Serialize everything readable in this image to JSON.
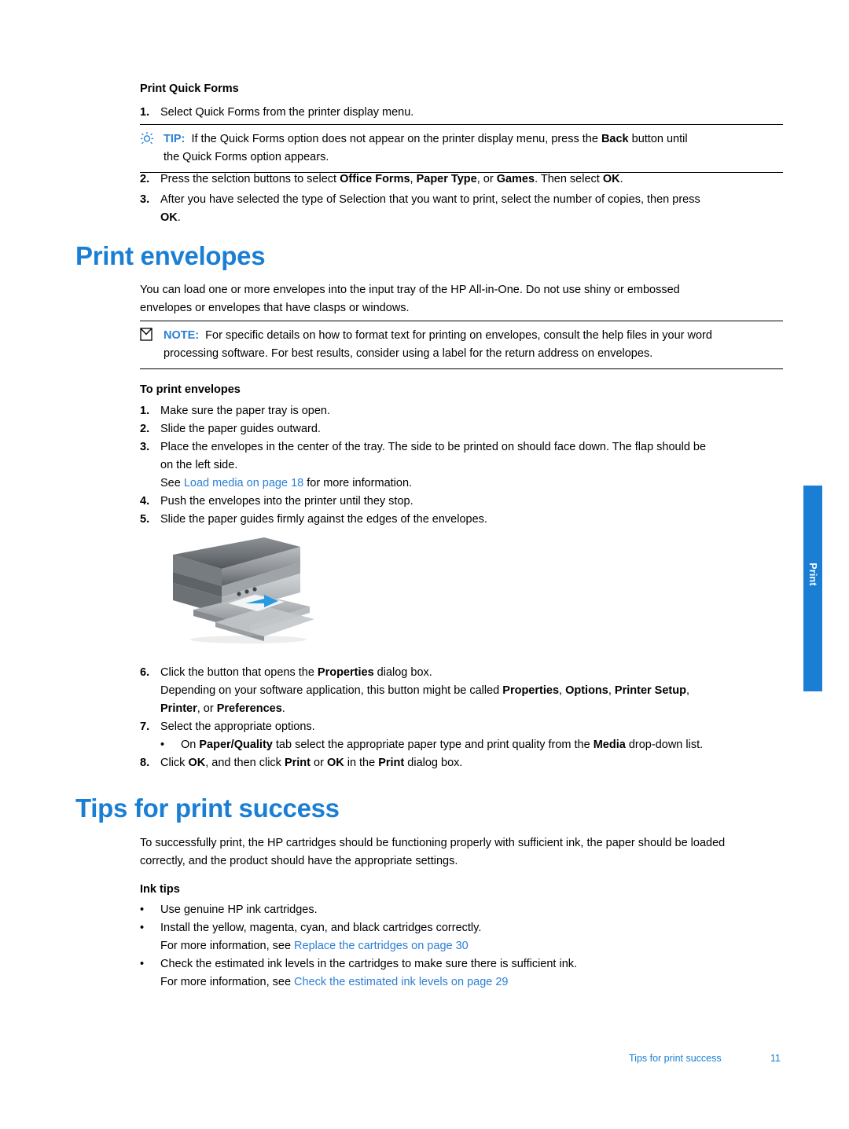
{
  "sections": {
    "quick_forms": {
      "heading": "Print Quick Forms",
      "steps": [
        {
          "num": "1.",
          "text": "Select Quick Forms from the printer display menu."
        },
        {
          "num": "2.",
          "text": "Press the selction buttons to select "
        },
        {
          "num": "3.",
          "text": "After you have selected the type of Selection that you want to print, select the number of copies, then press "
        }
      ],
      "step2_parts": {
        "b1": "Office Forms",
        "sep1": ", ",
        "b2": "Paper Type",
        "sep2": ", or ",
        "b3": "Games",
        "tail": ". Then select ",
        "b4": "OK",
        "end": "."
      },
      "step3_end_bold": "OK",
      "step3_end": ".",
      "tip": {
        "icon": "tip-bulb-icon",
        "label": "TIP:",
        "text_line1": "If the Quick Forms option does not appear on the printer display menu, press the ",
        "bold1": "Back",
        "text_line1b": " button until",
        "text_line2": "the Quick Forms option appears."
      }
    },
    "print_envelopes": {
      "title": "Print envelopes",
      "intro_line1": "You can load one or more envelopes into the input tray of the HP All-in-One. Do not use shiny or embossed",
      "intro_line2": "envelopes or envelopes that have clasps or windows.",
      "note": {
        "icon": "note-icon",
        "label": "NOTE:",
        "line1": "For specific details on how to format text for printing on envelopes, consult the help files in your word",
        "line2": "processing software. For best results, consider using a label for the return address on envelopes."
      },
      "sub_heading": "To print envelopes",
      "steps": [
        {
          "num": "1.",
          "text": "Make sure the paper tray is open."
        },
        {
          "num": "2.",
          "text": "Slide the paper guides outward."
        },
        {
          "num": "3.",
          "line1": "Place the envelopes in the center of the tray. The side to be printed on should face down. The flap should be",
          "line2": "on the left side.",
          "line3_pre": "See ",
          "line3_link": "Load media on page 18",
          "line3_post": " for more information."
        },
        {
          "num": "4.",
          "text": "Push the envelopes into the printer until they stop."
        },
        {
          "num": "5.",
          "text": "Slide the paper guides firmly against the edges of the envelopes."
        }
      ],
      "steps_after_image": [
        {
          "num": "6.",
          "line1_pre": "Click the button that opens the ",
          "line1_bold": "Properties",
          "line1_post": " dialog box.",
          "line2_pre": "Depending on your software application, this button might be called ",
          "line2_b1": "Properties",
          "line2_s1": ", ",
          "line2_b2": "Options",
          "line2_s2": ", ",
          "line2_b3": "Printer Setup",
          "line2_s3": ",",
          "line3_b1": "Printer",
          "line3_s1": ", or ",
          "line3_b2": "Preferences",
          "line3_s2": "."
        },
        {
          "num": "7.",
          "text": "Select the appropriate options."
        }
      ],
      "bullet_paper_quality": {
        "pre": "On ",
        "b1": "Paper/Quality",
        "mid": " tab select the appropriate paper type and print quality from the ",
        "b2": "Media",
        "post": " drop-down list."
      },
      "step8": {
        "num": "8.",
        "pre": "Click ",
        "b1": "OK",
        "mid1": ", and then click ",
        "b2": "Print",
        "mid2": " or ",
        "b3": "OK",
        "mid3": " in the ",
        "b4": "Print",
        "post": " dialog box."
      }
    },
    "tips": {
      "title": "Tips for print success",
      "intro_line1": "To successfully print, the HP cartridges should be functioning properly with sufficient ink, the paper should be loaded",
      "intro_line2": "correctly, and the product should have the appropriate settings.",
      "sub_heading": "Ink tips",
      "bullets": [
        {
          "text": "Use genuine HP ink cartridges."
        },
        {
          "line1": "Install the yellow, magenta, cyan, and black cartridges correctly.",
          "line2_pre": "For more information, see ",
          "line2_link": "Replace the cartridges on page 30",
          "line2_post": ""
        },
        {
          "line1": "Check the estimated ink levels in the cartridges to make sure there is sufficient ink.",
          "line2_pre": "For more information, see ",
          "line2_link": "Check the estimated ink levels on page 29",
          "line2_post": ""
        }
      ]
    }
  },
  "side_tab": {
    "label": "Print"
  },
  "footer": {
    "title": "Tips for print success",
    "page_number": "11"
  },
  "colors": {
    "heading_blue": "#1a7fd4",
    "link_blue": "#2b7fd4",
    "tab_blue": "#1a7fd4"
  }
}
